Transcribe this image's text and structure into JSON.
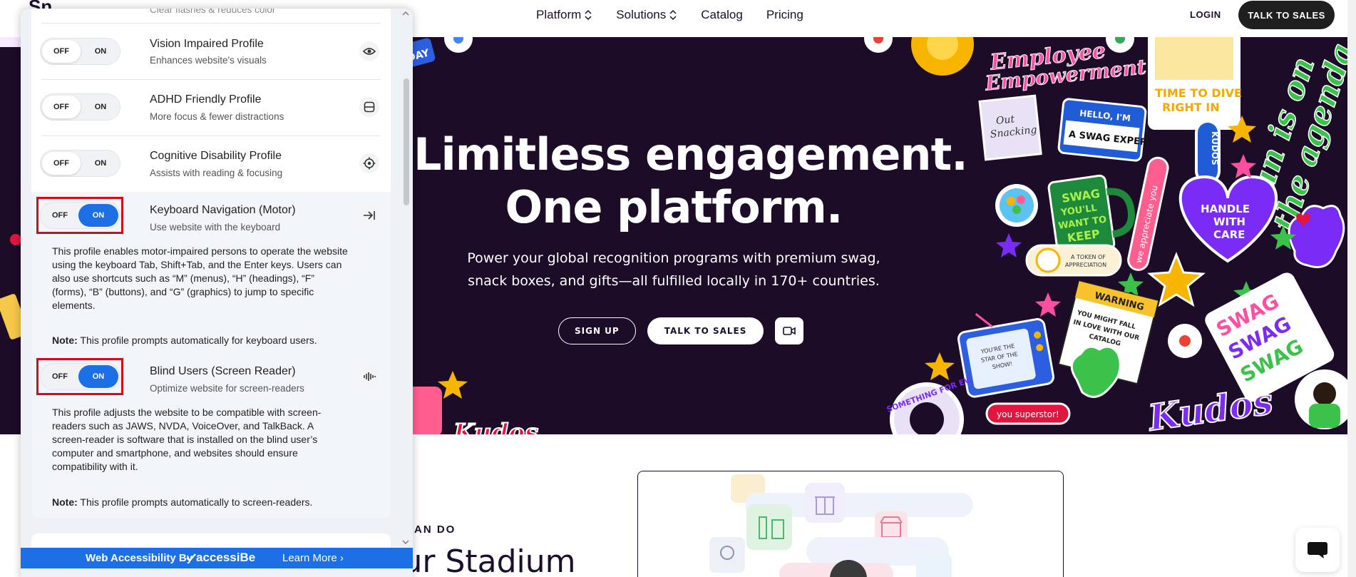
{
  "header": {
    "logo_fragment": "Sn",
    "nav": [
      {
        "label": "Platform"
      },
      {
        "label": "Solutions"
      },
      {
        "label": "Catalog"
      },
      {
        "label": "Pricing"
      }
    ],
    "login_label": "LOGIN",
    "talk_to_sales_label": "TALK TO SALES"
  },
  "hero": {
    "title_line1": "Limitless engagement.",
    "title_line2": "One platform.",
    "subtitle_line1": "Power your global recognition programs with premium swag,",
    "subtitle_line2": "snack boxes, and gifts—all fulfilled locally in 170+ countries.",
    "signup_label": "SIGN UP",
    "talk_to_sales_label": "TALK TO SALES",
    "stickers": {
      "employee": "Employee",
      "empowerment": "Empowerment",
      "time_to_dive": "TIME TO DIVE",
      "right_in": "RIGHT IN",
      "fun_agenda_1": "Fun is on",
      "fun_agenda_2": "the agenda",
      "hello_im": "HELLO, I'M",
      "swag_expert": "A SWAG EXPERT",
      "out_snacking_1": "Out",
      "out_snacking_2": "Snacking",
      "kudos_vertical": "KUDOS",
      "appreciate": "we appreciate you",
      "mug_1": "SWAG",
      "mug_2": "YOU'LL",
      "mug_3": "WANT TO",
      "mug_4": "KEEP",
      "handle_1": "HANDLE",
      "handle_2": "WITH",
      "handle_3": "CARE",
      "token_1": "A TOKEN OF",
      "token_2": "APPRECIATION",
      "warning_title": "WARNING",
      "warning_1": "YOU MIGHT FALL",
      "warning_2": "IN LOVE WITH OUR",
      "warning_3": "CATALOG",
      "swag_word": "SWAG",
      "tv_1": "YOU'RE THE",
      "tv_2": "STAR OF THE",
      "tv_3": "SHOW!",
      "superstar": "you superstor!",
      "kudos_script": "Kudos",
      "kudos_left": "Kudos",
      "something": "SOMETHING FOR EV",
      "day": "DAY"
    }
  },
  "section": {
    "eyebrow": "AN DO",
    "title": "Take your Stadium"
  },
  "accessibility": {
    "top_fragment": "Clear flashes & reduces color",
    "toggle_off": "OFF",
    "toggle_on": "ON",
    "profiles": [
      {
        "name": "Vision Impaired Profile",
        "desc": "Enhances website's visuals",
        "icon": "eye-icon",
        "state": "off"
      },
      {
        "name": "ADHD Friendly Profile",
        "desc": "More focus & fewer distractions",
        "icon": "focus-frame-icon",
        "state": "off"
      },
      {
        "name": "Cognitive Disability Profile",
        "desc": "Assists with reading & focusing",
        "icon": "target-icon",
        "state": "off"
      },
      {
        "name": "Keyboard Navigation (Motor)",
        "desc": "Use website with the keyboard",
        "icon": "arrow-to-line-icon",
        "state": "on",
        "body_lines": [
          "This profile enables motor-impaired persons to operate the website",
          "using the keyboard Tab, Shift+Tab, and the Enter keys. Users can",
          "also use shortcuts such as “M” (menus), “H” (headings), “F”",
          "(forms), “B” (buttons), and “G” (graphics) to jump to specific",
          "elements."
        ],
        "note_label": "Note:",
        "note_text": " This profile prompts automatically for keyboard users."
      },
      {
        "name": "Blind Users (Screen Reader)",
        "desc": "Optimize website for screen-readers",
        "icon": "audio-wave-icon",
        "state": "on",
        "body_lines": [
          "This profile adjusts the website to be compatible with screen-",
          "readers such as JAWS, NVDA, VoiceOver, and TalkBack. A",
          "screen-reader is software that is installed on the blind user’s",
          "computer and smartphone, and websites should ensure",
          "compatibility with it."
        ],
        "note_label": "Note:",
        "note_text": " This profile prompts automatically to screen-readers."
      }
    ],
    "footer": {
      "by_label": "Web Accessibility By",
      "brand": "accessiBe",
      "learn_more": "Learn More"
    }
  },
  "colors": {
    "hero_bg": "#1c0c28",
    "accent_blue": "#1c6fe4",
    "highlight_red": "#d40c1a"
  }
}
